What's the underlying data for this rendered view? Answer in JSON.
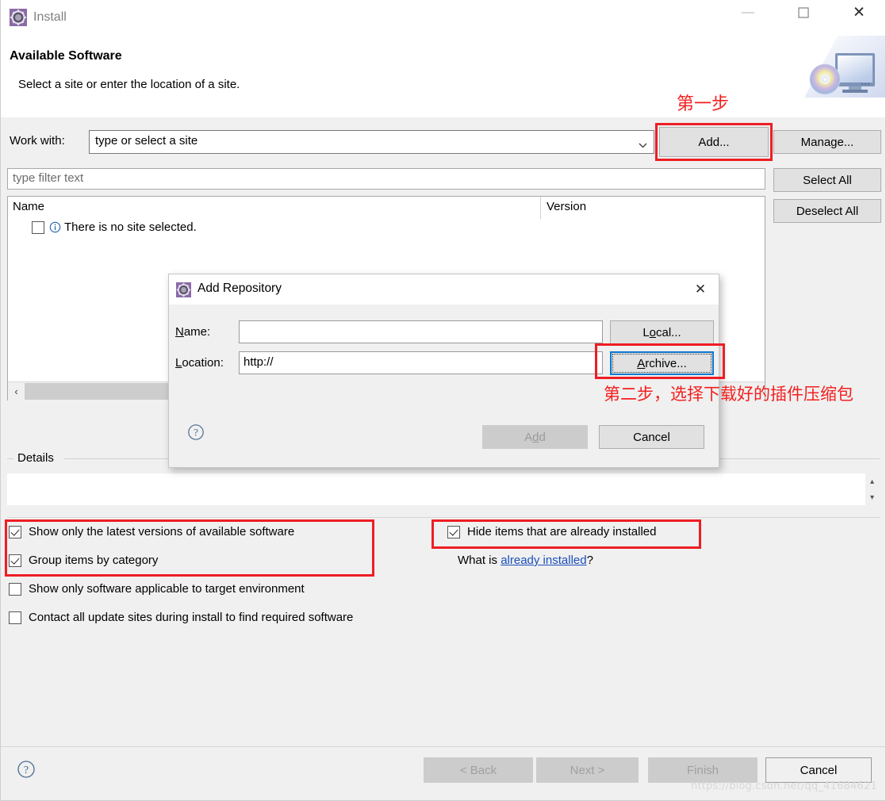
{
  "window": {
    "title": "Install",
    "icon": "install-gear-icon",
    "controls": {
      "minimize": "minimize-icon",
      "maximize": "maximize-icon",
      "close": "close-icon"
    }
  },
  "header": {
    "title": "Available Software",
    "subtitle": "Select a site or enter the location of a site.",
    "banner_icon": "monitor-cd-icon"
  },
  "work_with": {
    "label": "Work with:",
    "value": "type or select a site",
    "placeholder": "type or select a site",
    "dropdown_icon": "chevron-down-icon"
  },
  "side_buttons": {
    "add": "Add...",
    "manage": "Manage...",
    "select_all": "Select All",
    "deselect_all": "Deselect All"
  },
  "filter": {
    "placeholder": "type filter text",
    "value": "type filter text"
  },
  "tree": {
    "columns": [
      "Name",
      "Version"
    ],
    "rows": [
      {
        "checked": false,
        "icon": "info-icon",
        "label": "There is no site selected.",
        "version": ""
      }
    ],
    "scrollbar": {
      "left_arrow": "‹"
    }
  },
  "details": {
    "label": "Details",
    "content": "",
    "spinner_up": "▴",
    "spinner_down": "▾"
  },
  "options": [
    {
      "id": "show-latest-versions",
      "label": "Show only the latest versions of available software",
      "checked": true
    },
    {
      "id": "group-items-by-category",
      "label": "Group items by category",
      "checked": true
    },
    {
      "id": "show-only-applicable",
      "label": "Show only software applicable to target environment",
      "checked": false
    },
    {
      "id": "contact-all-update-sites",
      "label": "Contact all update sites during install to find required software",
      "checked": false
    },
    {
      "id": "hide-already-installed",
      "label": "Hide items that are already installed",
      "checked": true
    }
  ],
  "what_is": {
    "prefix": "What is ",
    "link": "already installed",
    "suffix": "?"
  },
  "wizard_buttons": {
    "help": "help-icon",
    "back": "< Back",
    "next": "Next >",
    "finish": "Finish",
    "cancel": "Cancel"
  },
  "dialog": {
    "title": "Add Repository",
    "icon": "install-gear-icon",
    "close": "✕",
    "name_label_pre": "N",
    "name_label_post": "ame:",
    "name_value": "",
    "location_label_pre": "L",
    "location_label_post": "ocation:",
    "location_value": "http://",
    "local_pre": "L",
    "local_mid": "o",
    "local_post": "cal...",
    "archive_pre": "A",
    "archive_post": "rchive...",
    "add_pre": "A",
    "add_mid": "d",
    "add_post": "d",
    "cancel": "Cancel",
    "help": "help-icon"
  },
  "annotations": {
    "step1": "第一步",
    "step2": "第二步，选择下载好的插件压缩包",
    "color": "#f3201f"
  },
  "watermark": "https://blog.csdn.net/qq_41684621"
}
